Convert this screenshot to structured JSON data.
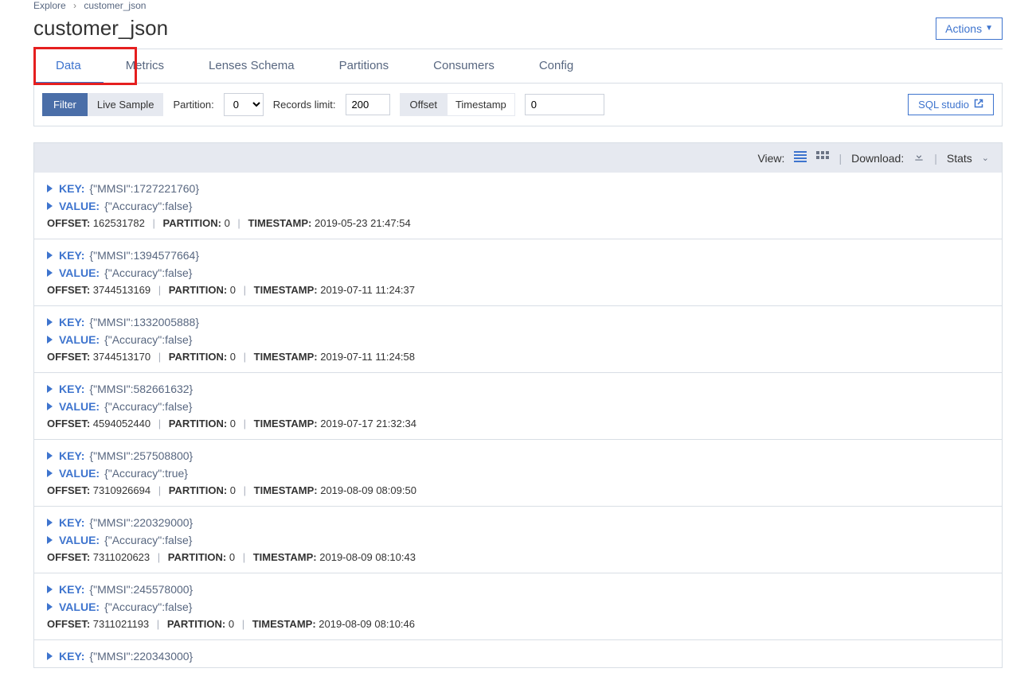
{
  "breadcrumb": {
    "parent": "Explore",
    "current": "customer_json"
  },
  "title": "customer_json",
  "actions_button": "Actions",
  "tabs": {
    "data": "Data",
    "metrics": "Metrics",
    "schema": "Lenses Schema",
    "partitions": "Partitions",
    "consumers": "Consumers",
    "config": "Config"
  },
  "toolbar": {
    "filter": "Filter",
    "live_sample": "Live Sample",
    "partition_label": "Partition:",
    "partition_value": "0",
    "records_limit_label": "Records limit:",
    "records_limit_value": "200",
    "offset_btn": "Offset",
    "timestamp_btn": "Timestamp",
    "timestamp_value": "0",
    "sql_studio": "SQL studio"
  },
  "panel": {
    "view_label": "View:",
    "download_label": "Download:",
    "stats_label": "Stats"
  },
  "labels": {
    "key": "KEY:",
    "value": "VALUE:",
    "offset": "OFFSET:",
    "partition": "PARTITION:",
    "timestamp": "TIMESTAMP:"
  },
  "records": [
    {
      "key": "{\"MMSI\":1727221760}",
      "value": "{\"Accuracy\":false}",
      "offset": "162531782",
      "partition": "0",
      "timestamp": "2019-05-23 21:47:54"
    },
    {
      "key": "{\"MMSI\":1394577664}",
      "value": "{\"Accuracy\":false}",
      "offset": "3744513169",
      "partition": "0",
      "timestamp": "2019-07-11 11:24:37"
    },
    {
      "key": "{\"MMSI\":1332005888}",
      "value": "{\"Accuracy\":false}",
      "offset": "3744513170",
      "partition": "0",
      "timestamp": "2019-07-11 11:24:58"
    },
    {
      "key": "{\"MMSI\":582661632}",
      "value": "{\"Accuracy\":false}",
      "offset": "4594052440",
      "partition": "0",
      "timestamp": "2019-07-17 21:32:34"
    },
    {
      "key": "{\"MMSI\":257508800}",
      "value": "{\"Accuracy\":true}",
      "offset": "7310926694",
      "partition": "0",
      "timestamp": "2019-08-09 08:09:50"
    },
    {
      "key": "{\"MMSI\":220329000}",
      "value": "{\"Accuracy\":false}",
      "offset": "7311020623",
      "partition": "0",
      "timestamp": "2019-08-09 08:10:43"
    },
    {
      "key": "{\"MMSI\":245578000}",
      "value": "{\"Accuracy\":false}",
      "offset": "7311021193",
      "partition": "0",
      "timestamp": "2019-08-09 08:10:46"
    }
  ],
  "partial_record": {
    "key": "{\"MMSI\":220343000}"
  }
}
